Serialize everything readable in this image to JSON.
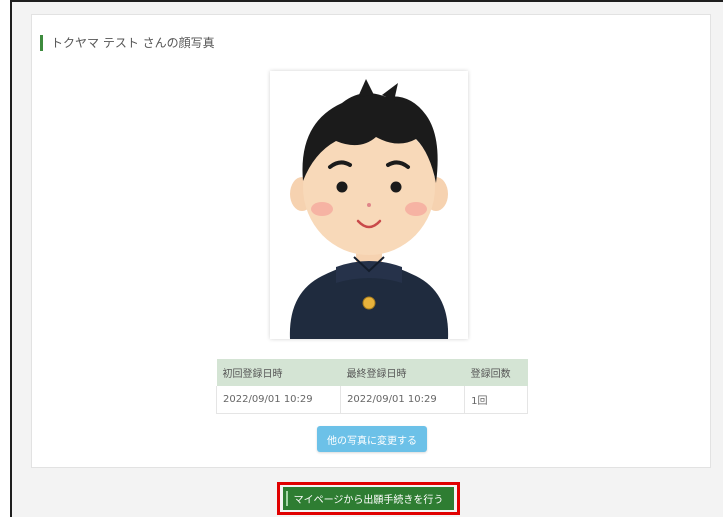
{
  "heading": {
    "title": "トクヤマ テスト さんの顔写真"
  },
  "photo": {
    "description_icon": "student-avatar-icon"
  },
  "info_table": {
    "headers": [
      "初回登録日時",
      "最終登録日時",
      "登録回数"
    ],
    "rows": [
      [
        "2022/09/01 10:29",
        "2022/09/01 10:29",
        "1回"
      ]
    ]
  },
  "buttons": {
    "change_photo": "他の写真に変更する",
    "mypage_procedure": "マイページから出願手続きを行う"
  },
  "colors": {
    "accent_green": "#2e7d32",
    "button_blue": "#6cc1e8",
    "highlight_red": "#e00000",
    "table_header": "#d4e4d4"
  }
}
